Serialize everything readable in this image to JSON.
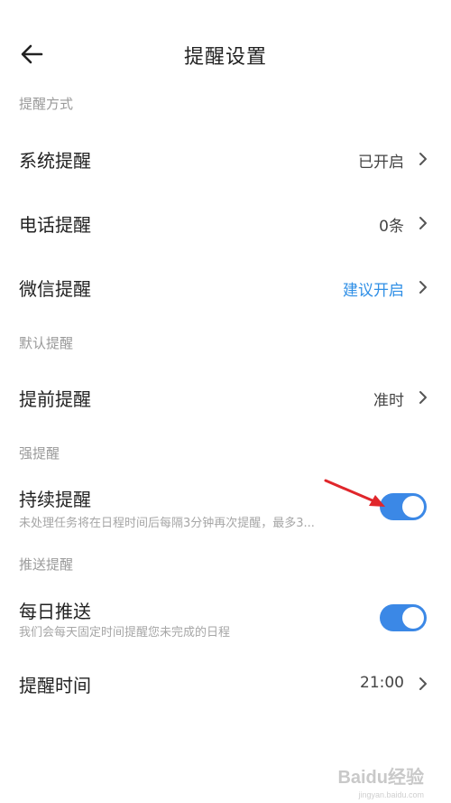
{
  "header": {
    "title": "提醒设置",
    "back_icon": "arrow-left-icon"
  },
  "sections": {
    "method": {
      "label": "提醒方式"
    },
    "default": {
      "label": "默认提醒"
    },
    "strong": {
      "label": "强提醒"
    },
    "push": {
      "label": "推送提醒"
    }
  },
  "rows": {
    "system": {
      "title": "系统提醒",
      "value": "已开启"
    },
    "phone": {
      "title": "电话提醒",
      "value": "0条"
    },
    "wechat": {
      "title": "微信提醒",
      "value": "建议开启",
      "value_color": "#2f8fe6"
    },
    "advance": {
      "title": "提前提醒",
      "value": "准时"
    },
    "continuous": {
      "title": "持续提醒",
      "subtitle": "未处理任务将在日程时间后每隔3分钟再次提醒，最多3...",
      "toggle_on": true
    },
    "daily": {
      "title": "每日推送",
      "subtitle": "我们会每天固定时间提醒您未完成的日程",
      "toggle_on": true
    },
    "time": {
      "title": "提醒时间",
      "value": "21:00"
    }
  },
  "colors": {
    "accent": "#2f8fe6",
    "toggle_on": "#3b88e6",
    "annotation_arrow": "#e0262b"
  },
  "watermark": {
    "brand": "Baidu经验",
    "url": "jingyan.baidu.com"
  }
}
